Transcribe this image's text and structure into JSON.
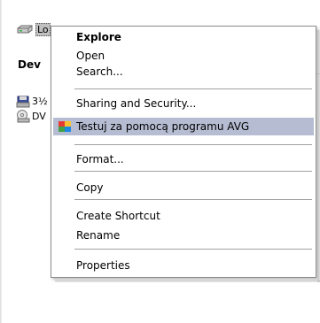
{
  "explorer": {
    "selected_drive_label": "Lo",
    "group_header": "Dev",
    "items": [
      {
        "label": "3½",
        "icon": "floppy-drive-icon"
      },
      {
        "label": "DV",
        "icon": "dvd-drive-icon"
      }
    ]
  },
  "context_menu": {
    "explore": "Explore",
    "open": "Open",
    "search": "Search...",
    "sharing": "Sharing and Security...",
    "avg_scan": "Testuj za pomocą programu AVG",
    "format": "Format...",
    "copy": "Copy",
    "create_shortcut": "Create Shortcut",
    "rename": "Rename",
    "properties": "Properties",
    "highlight_color": "#b6bdd2",
    "avg_icon": "avg-icon"
  }
}
